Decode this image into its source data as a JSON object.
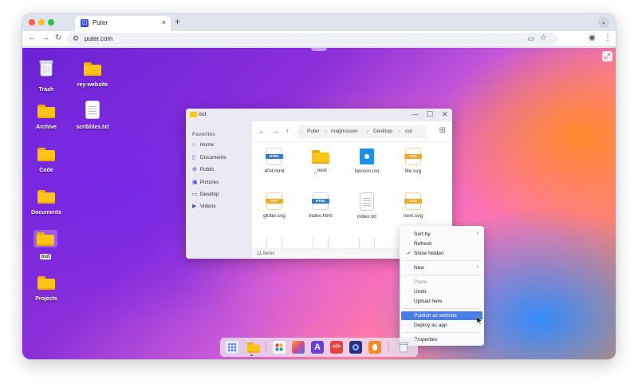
{
  "browser": {
    "tab_title": "Puter",
    "tab_close": "×",
    "new_tab": "+",
    "chevron": "⌄",
    "url": "puter.com",
    "icons": [
      "back-arrow",
      "forward-arrow",
      "reload",
      "site-settings",
      "cast",
      "bookmark-star",
      "profile",
      "more-vert"
    ]
  },
  "desktop": {
    "icons": [
      {
        "label": "Trash",
        "type": "trash"
      },
      {
        "label": "rey-website",
        "type": "folder"
      },
      {
        "label": "Archive",
        "type": "folder"
      },
      {
        "label": "scribbles.txt",
        "type": "text-file"
      },
      {
        "label": "Code",
        "type": "folder"
      },
      {
        "label": "Documents",
        "type": "folder"
      },
      {
        "label": "out",
        "type": "folder",
        "selected": true
      },
      {
        "label": "Projects",
        "type": "folder"
      }
    ]
  },
  "explorer": {
    "title": "out",
    "sidebar_title": "Favorites",
    "sidebar": [
      {
        "label": "Home",
        "icon": "home-icon"
      },
      {
        "label": "Documents",
        "icon": "document-icon"
      },
      {
        "label": "Public",
        "icon": "globe-icon"
      },
      {
        "label": "Pictures",
        "icon": "image-icon"
      },
      {
        "label": "Desktop",
        "icon": "desktop-icon"
      },
      {
        "label": "Videos",
        "icon": "video-icon"
      }
    ],
    "breadcrumb": [
      "Puter",
      "magnussen",
      "Desktop",
      "out"
    ],
    "files": [
      {
        "name": "404.html",
        "kind": "html"
      },
      {
        "name": "_next",
        "kind": "folder"
      },
      {
        "name": "favicon.ico",
        "kind": "image"
      },
      {
        "name": "file.svg",
        "kind": "svg"
      },
      {
        "name": "globe.svg",
        "kind": "svg"
      },
      {
        "name": "index.html",
        "kind": "html"
      },
      {
        "name": "index.txt",
        "kind": "text"
      },
      {
        "name": "next.svg",
        "kind": "svg"
      }
    ],
    "status": "11 items",
    "badge_html": "HTML",
    "badge_svg": "SVG"
  },
  "context_menu": {
    "items": [
      {
        "label": "Sort by",
        "submenu": true
      },
      {
        "label": "Refresh"
      },
      {
        "label": "Show hidden",
        "checked": true
      },
      {
        "label": "New",
        "submenu": true
      },
      {
        "label": "Paste",
        "disabled": true
      },
      {
        "label": "Undo"
      },
      {
        "label": "Upload here"
      },
      {
        "label": "Publish as website",
        "highlighted": true
      },
      {
        "label": "Deploy as app"
      },
      {
        "label": "Properties"
      }
    ]
  },
  "colors": {
    "accent": "#4a7ee6",
    "folder": "#fcc419"
  }
}
